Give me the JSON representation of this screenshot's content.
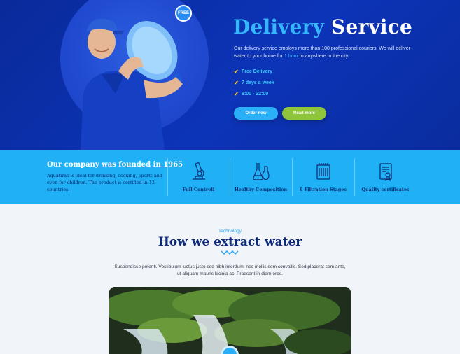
{
  "hero": {
    "badge": "FREE",
    "title_part1": "Delivery",
    "title_part2": "Service",
    "desc_before": "Our delivery service employs more than 100 professional couriers. We will deliver water to your home for ",
    "desc_highlight": "1 hour",
    "desc_after": " to anywhere in the city.",
    "checklist": [
      "Free Delivery",
      "7 days a week",
      "8:00 - 22:00"
    ],
    "order_button": "Order now",
    "more_button": "Read more"
  },
  "band": {
    "heading": "Our company was founded in 1965",
    "text": "Aquatiras is ideal for drinking, cooking, sports and even for children. The product is certified in 12 countries.",
    "features": [
      {
        "label": "Full Controll",
        "icon": "microscope-icon"
      },
      {
        "label": "Healthy Composition",
        "icon": "flasks-icon"
      },
      {
        "label": "6 Filtration Stages",
        "icon": "filter-icon"
      },
      {
        "label": "Quality certificates",
        "icon": "certificate-icon"
      }
    ]
  },
  "technology": {
    "label": "Technology",
    "title": "How we extract water",
    "desc": "Suspendisse potenti. Vestibulum luctus justo sed nibh interdum, nec mollis sem convallis. Sed placerat sem ante, ut aliquam mauris lacinia ac. Praesent in diam eros."
  },
  "colors": {
    "hero_bg": "#0c34b8",
    "accent_blue": "#2ab0f7",
    "accent_green": "#8fc53a",
    "band_bg": "#1fb0f6",
    "title_navy": "#0c2a7a"
  }
}
